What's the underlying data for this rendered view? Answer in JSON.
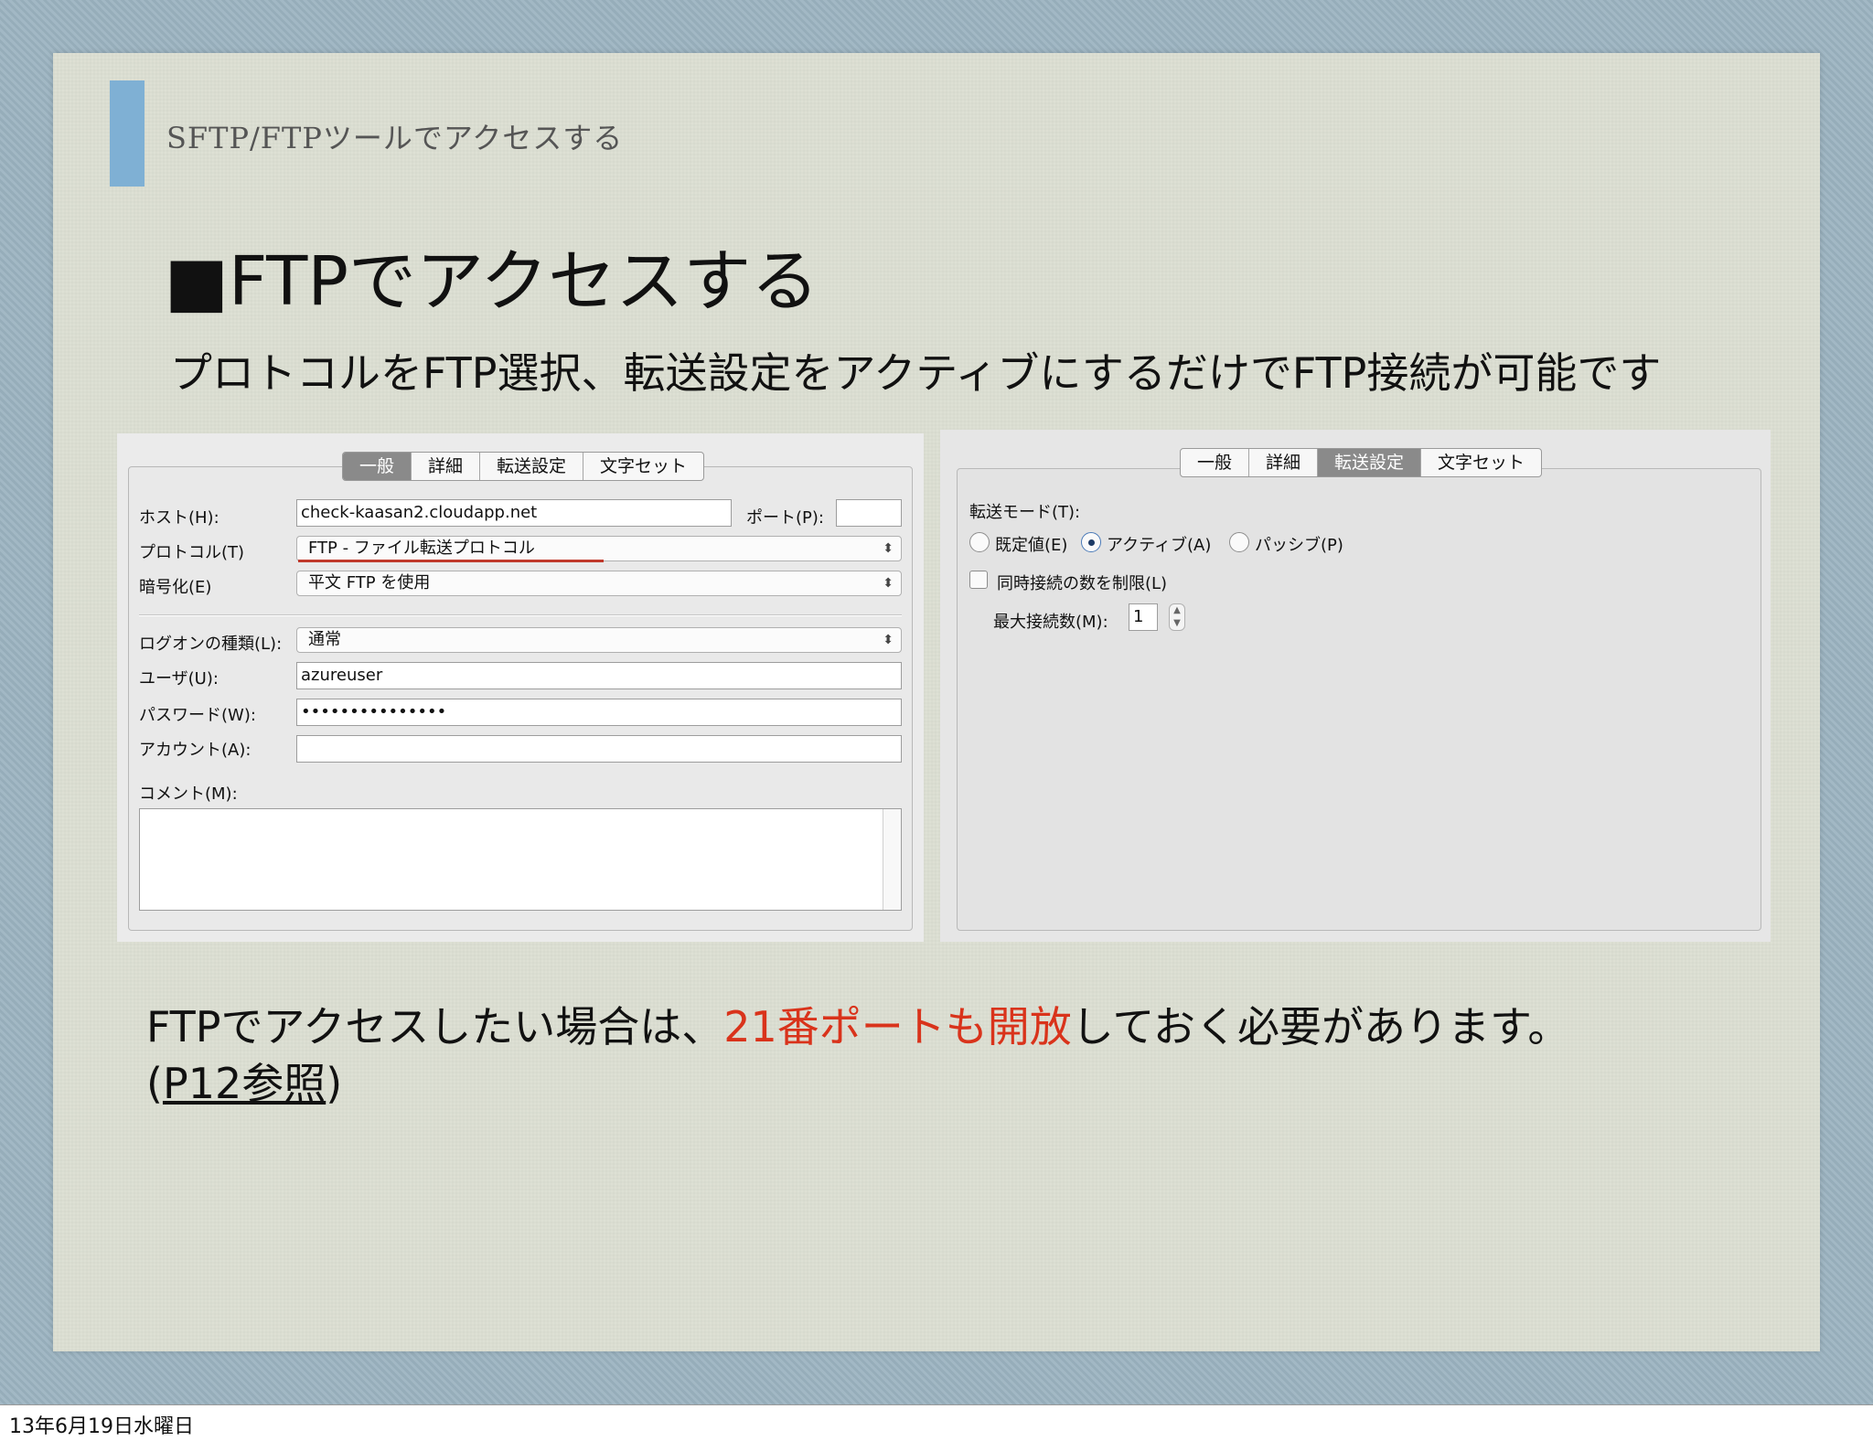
{
  "slide": {
    "subtitle": "SFTP/FTPツールでアクセスする",
    "title": "■FTPでアクセスする",
    "description": "プロトコルをFTP選択、転送設定をアクティブにするだけでFTP接続が可能です"
  },
  "left_dialog": {
    "tabs": [
      "一般",
      "詳細",
      "転送設定",
      "文字セット"
    ],
    "active_tab": "一般",
    "host_label": "ホスト(H):",
    "host_value": "check-kaasan2.cloudapp.net",
    "port_label": "ポート(P):",
    "port_value": "",
    "protocol_label": "プロトコル(T)",
    "protocol_value": "FTP - ファイル転送プロトコル",
    "encryption_label": "暗号化(E)",
    "encryption_value": "平文 FTP を使用",
    "logon_type_label": "ログオンの種類(L):",
    "logon_type_value": "通常",
    "user_label": "ユーザ(U):",
    "user_value": "azureuser",
    "password_label": "パスワード(W):",
    "password_value": "•••••••••••••••",
    "account_label": "アカウント(A):",
    "account_value": "",
    "comment_label": "コメント(M):",
    "accent_color": "#c0392b"
  },
  "right_dialog": {
    "tabs": [
      "一般",
      "詳細",
      "転送設定",
      "文字セット"
    ],
    "active_tab": "転送設定",
    "transfer_mode_label": "転送モード(T):",
    "radio_default": "既定値(E)",
    "radio_active": "アクティブ(A)",
    "radio_passive": "パッシブ(P)",
    "selected_mode": "アクティブ(A)",
    "limit_connections_label": "同時接続の数を制限(L)",
    "limit_connections_checked": false,
    "max_connections_label": "最大接続数(M):",
    "max_connections_value": "1"
  },
  "note": {
    "line1_before": "FTPでアクセスしたい場合は、",
    "line1_highlight": "21番ポートも開放",
    "line1_after": "しておく必要があります。",
    "line2_open": "(",
    "line2_ref": "P12参照",
    "line2_close": ")",
    "highlight_color": "#d9331b"
  },
  "footer": {
    "date": "13年6月19日水曜日"
  }
}
